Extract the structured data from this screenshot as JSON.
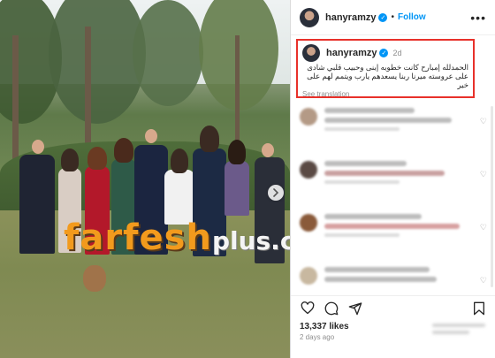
{
  "post": {
    "username": "hanyramzy",
    "follow_label": "Follow",
    "separator": "•",
    "more_glyph": "•••",
    "verified_glyph": "✓"
  },
  "caption": {
    "username": "hanyramzy",
    "time": "2d",
    "text": "الحمدلله إمبارح كانت خطوبه إبنى وحبيب قلبي شادى على عروسته ميرنا ربنا يسعدهم يارب ويتمم لهم على خير",
    "see_translation": "See translation"
  },
  "photo": {
    "watermark_brand": "farfesh",
    "watermark_suffix": "plus.com",
    "next_glyph": "›"
  },
  "engagement": {
    "likes": "13,337 likes",
    "posted": "2 days ago"
  },
  "icons": [
    "heart-icon",
    "comment-icon",
    "share-icon",
    "bookmark-icon",
    "chevron-right-icon",
    "verified-icon"
  ],
  "colors": {
    "accent": "#0095f6",
    "highlight_border": "#e8312a",
    "watermark": "#f29a1d"
  }
}
